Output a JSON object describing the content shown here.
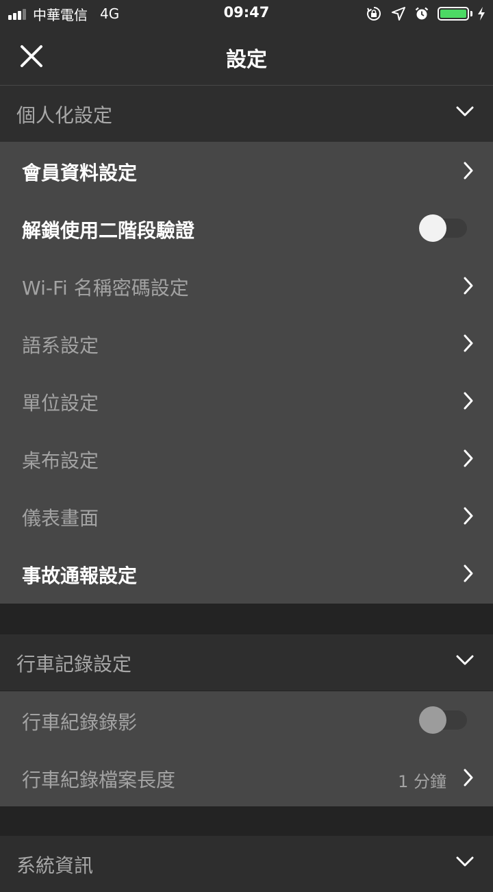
{
  "status_bar": {
    "carrier": "中華電信",
    "network": "4G",
    "time": "09:47",
    "icons": [
      "signal-icon",
      "orientation-lock-icon",
      "location-icon",
      "alarm-icon",
      "battery-icon",
      "charging-icon"
    ],
    "battery_color": "#4cd964"
  },
  "navbar": {
    "title": "設定",
    "close_icon": "close-icon"
  },
  "sections": {
    "personal": {
      "title": "個人化設定",
      "items": [
        {
          "label": "會員資料設定",
          "type": "link",
          "enabled": true
        },
        {
          "label": "解鎖使用二階段驗證",
          "type": "toggle",
          "enabled": true,
          "on": false
        },
        {
          "label": "Wi-Fi 名稱密碼設定",
          "type": "link",
          "enabled": false
        },
        {
          "label": "語系設定",
          "type": "link",
          "enabled": false
        },
        {
          "label": "單位設定",
          "type": "link",
          "enabled": false
        },
        {
          "label": "桌布設定",
          "type": "link",
          "enabled": false
        },
        {
          "label": "儀表畫面",
          "type": "link",
          "enabled": false
        },
        {
          "label": "事故通報設定",
          "type": "link",
          "enabled": true
        }
      ]
    },
    "driving": {
      "title": "行車記錄設定",
      "items": [
        {
          "label": "行車紀錄錄影",
          "type": "toggle",
          "enabled": false,
          "on": false
        },
        {
          "label": "行車紀錄檔案長度",
          "type": "link",
          "enabled": false,
          "value": "1 分鐘"
        }
      ]
    },
    "system": {
      "title": "系統資訊"
    }
  },
  "colors": {
    "background": "#232323",
    "header_bg": "#2e2e2e",
    "row_bg": "#474747",
    "text_active": "#ffffff",
    "text_dim": "#a3a3a3"
  }
}
